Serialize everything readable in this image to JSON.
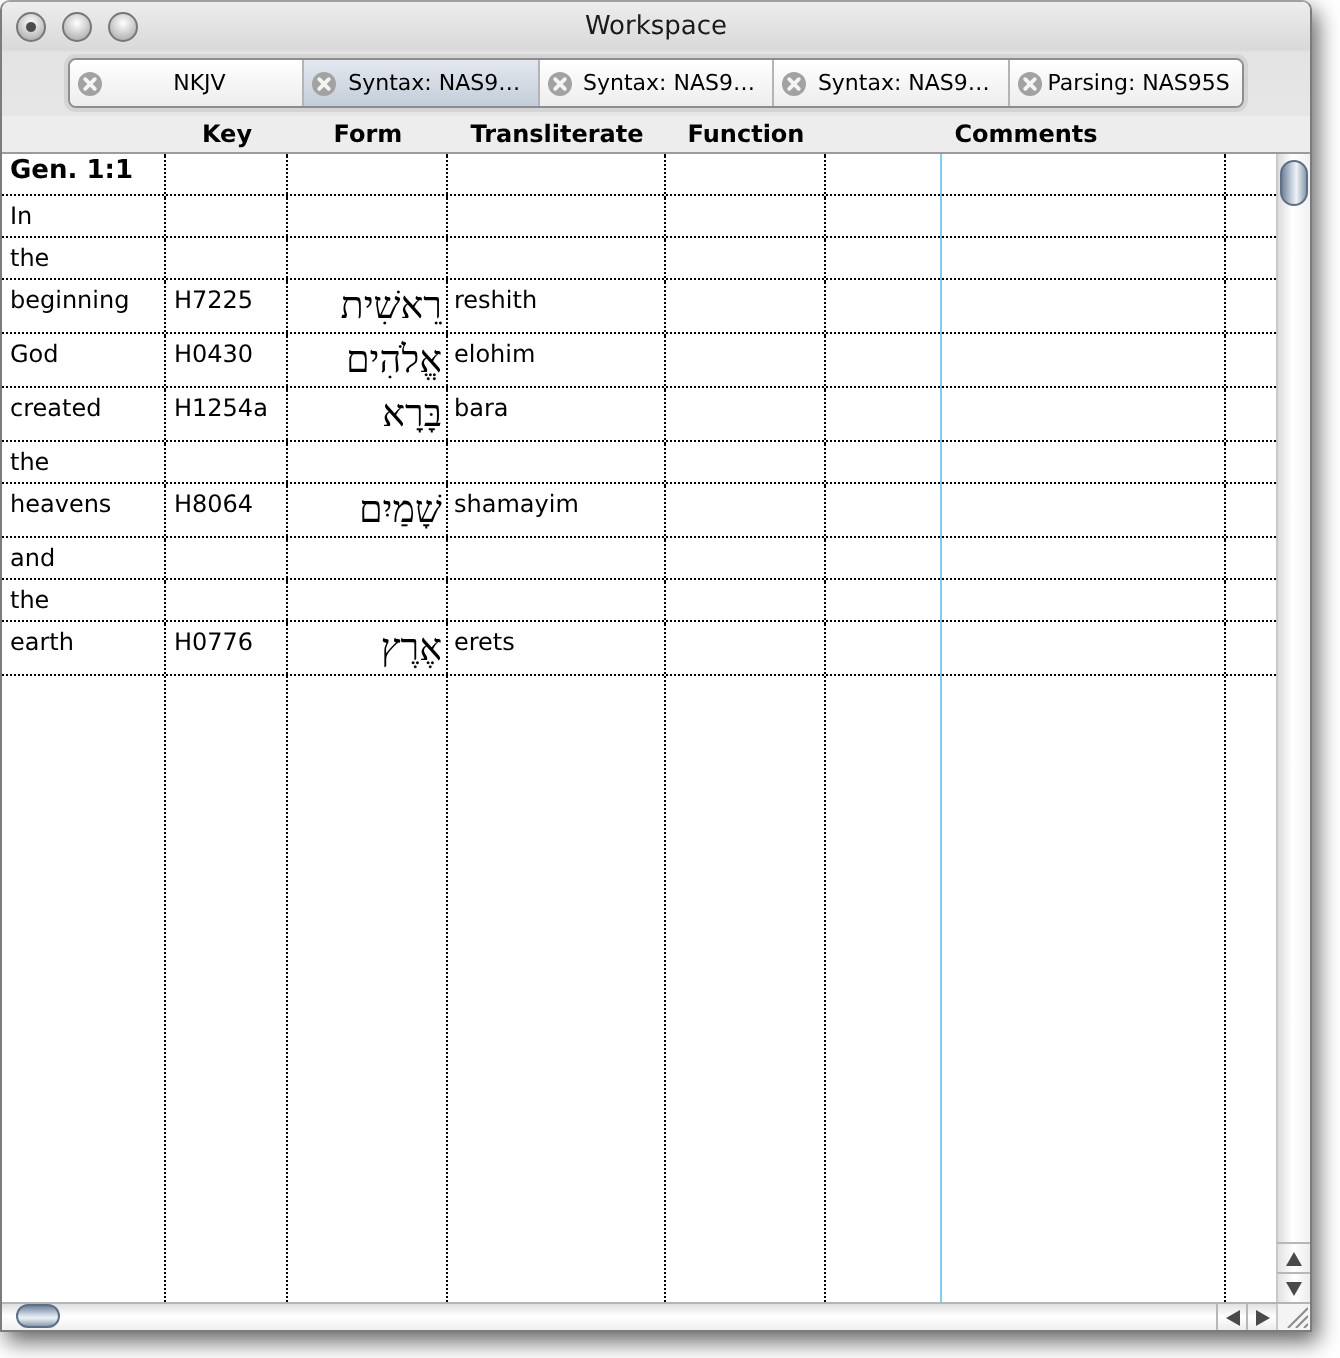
{
  "window": {
    "title": "Workspace"
  },
  "tabs": [
    {
      "label": "NKJV",
      "selected": false
    },
    {
      "label": "Syntax: NAS9…",
      "selected": true
    },
    {
      "label": "Syntax: NAS9…",
      "selected": false
    },
    {
      "label": "Syntax: NAS9…",
      "selected": false
    },
    {
      "label": "Parsing: NAS95S",
      "selected": false
    }
  ],
  "table": {
    "columns": [
      "Key",
      "Form",
      "Transliterate",
      "Function",
      "Comments"
    ],
    "passage": "Gen. 1:1",
    "rows": [
      {
        "word": "In"
      },
      {
        "word": "the"
      },
      {
        "word": "beginning",
        "key": "H7225",
        "form": "רֵאשִׁית",
        "transliterate": "reshith"
      },
      {
        "word": "God",
        "key": "H0430",
        "form": "אֱלֹהִים",
        "transliterate": "elohim"
      },
      {
        "word": "created",
        "key": "H1254a",
        "form": "בָּרָא",
        "transliterate": "bara"
      },
      {
        "word": "the"
      },
      {
        "word": "heavens",
        "key": "H8064",
        "form": "שָׁמַיִם",
        "transliterate": "shamayim"
      },
      {
        "word": "and"
      },
      {
        "word": "the"
      },
      {
        "word": "earth",
        "key": "H0776",
        "form": "אֶרֶץ",
        "transliterate": "erets"
      }
    ]
  }
}
